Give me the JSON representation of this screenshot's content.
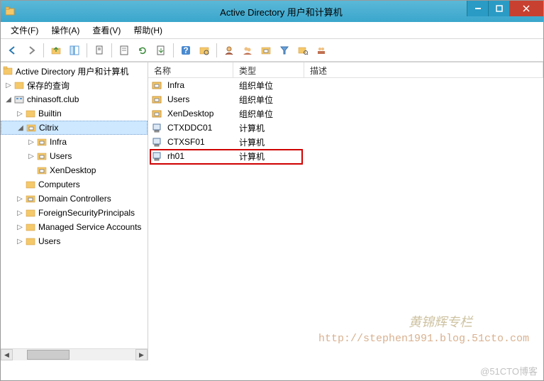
{
  "window": {
    "title": "Active Directory 用户和计算机"
  },
  "menu": {
    "file": "文件(F)",
    "action": "操作(A)",
    "view": "查看(V)",
    "help": "帮助(H)"
  },
  "tree": {
    "root": "Active Directory 用户和计算机",
    "saved_queries": "保存的查询",
    "domain": "chinasoft.club",
    "builtin": "Builtin",
    "citrix": "Citrix",
    "infra": "Infra",
    "users_ou": "Users",
    "xendesktop": "XenDesktop",
    "computers": "Computers",
    "domain_controllers": "Domain Controllers",
    "foreign_sp": "ForeignSecurityPrincipals",
    "msa": "Managed Service Accounts",
    "users": "Users"
  },
  "list": {
    "headers": {
      "name": "名称",
      "type": "类型",
      "desc": "描述"
    },
    "rows": [
      {
        "name": "Infra",
        "type": "组织单位",
        "icon": "ou"
      },
      {
        "name": "Users",
        "type": "组织单位",
        "icon": "ou"
      },
      {
        "name": "XenDesktop",
        "type": "组织单位",
        "icon": "ou"
      },
      {
        "name": "CTXDDC01",
        "type": "计算机",
        "icon": "computer"
      },
      {
        "name": "CTXSF01",
        "type": "计算机",
        "icon": "computer"
      },
      {
        "name": "rh01",
        "type": "计算机",
        "icon": "computer"
      }
    ]
  },
  "watermark": {
    "line1": "黄锦辉专栏",
    "line2": "http://stephen1991.blog.51cto.com",
    "line3": "@51CTO博客"
  }
}
